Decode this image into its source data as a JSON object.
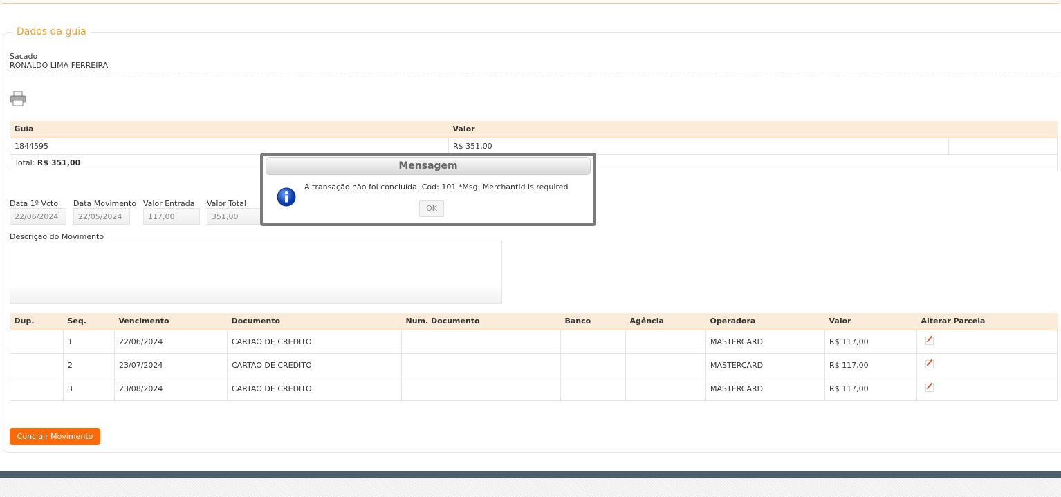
{
  "section_title": "Dados da guia",
  "sacado": {
    "label": "Sacado",
    "value": "RONALDO LIMA FERREIRA"
  },
  "guia_table": {
    "headers": [
      "Guia",
      "Valor",
      ""
    ],
    "rows": [
      [
        "1844595",
        "R$ 351,00",
        ""
      ]
    ],
    "total_label": "Total:",
    "total_value": "R$ 351,00"
  },
  "fields": [
    {
      "label": "Data 1º Vcto",
      "value": "22/06/2024"
    },
    {
      "label": "Data Movimento",
      "value": "22/05/2024"
    },
    {
      "label": "Valor Entrada",
      "value": "117,00"
    },
    {
      "label": "Valor Total",
      "value": "351,00"
    }
  ],
  "descricao_label": "Descrição do Movimento",
  "parcelas": {
    "headers": [
      "Dup.",
      "Seq.",
      "Vencimento",
      "Documento",
      "Num. Documento",
      "Banco",
      "Agência",
      "Operadora",
      "Valor",
      "Alterar Parcela"
    ],
    "rows": [
      [
        "",
        "1",
        "22/06/2024",
        "CARTAO DE CREDITO",
        "",
        "",
        "",
        "MASTERCARD",
        "R$ 117,00"
      ],
      [
        "",
        "2",
        "23/07/2024",
        "CARTAO DE CREDITO",
        "",
        "",
        "",
        "MASTERCARD",
        "R$ 117,00"
      ],
      [
        "",
        "3",
        "23/08/2024",
        "CARTAO DE CREDITO",
        "",
        "",
        "",
        "MASTERCARD",
        "R$ 117,00"
      ]
    ]
  },
  "concluir_label": "Concluir Movimento",
  "modal": {
    "title": "Mensagem",
    "message": "A transação não foi concluída. Cod: 101 *Msg: MerchantId is required",
    "ok_label": "OK",
    "icon": "info-icon"
  },
  "colors": {
    "accent": "#fa6a0a",
    "legend": "#f0a030",
    "header_bg": "#fbebd9",
    "footer": "#4c5f6c"
  }
}
